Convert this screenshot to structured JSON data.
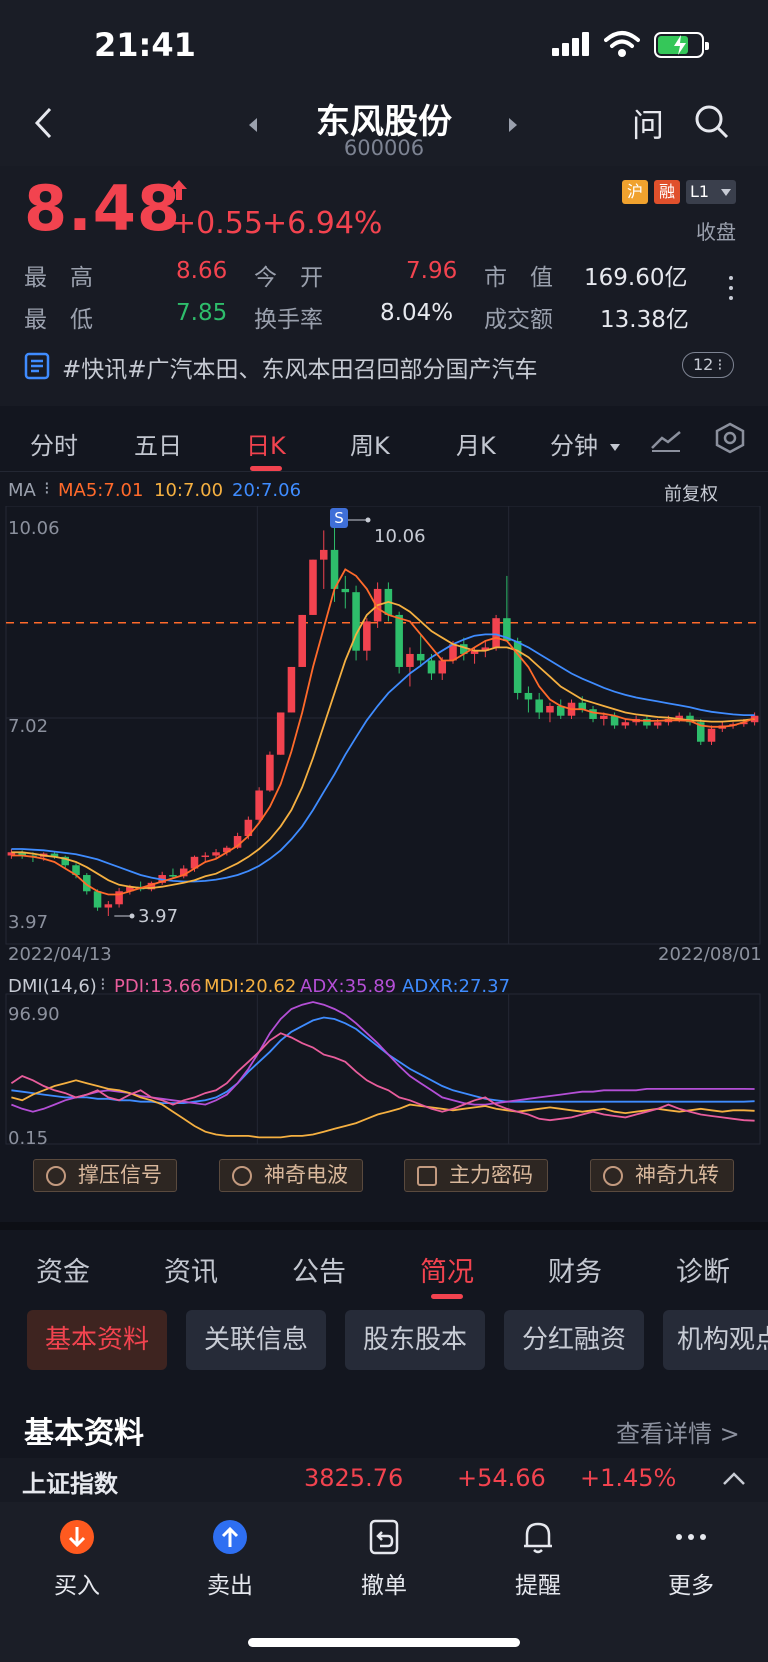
{
  "status": {
    "time": "21:41"
  },
  "nav": {
    "title": "东风股份",
    "code": "600006",
    "ask": "问"
  },
  "quote": {
    "price": "8.48",
    "change": "+0.55",
    "change_pct": "+6.94%",
    "tags": [
      "沪",
      "融",
      "L1"
    ],
    "market_state": "收盘",
    "high_label": "最　高",
    "high": "8.66",
    "open_label": "今　开",
    "open": "7.96",
    "mcap_label": "市　值",
    "mcap": "169.60亿",
    "low_label": "最　低",
    "low": "7.85",
    "turnover_label": "换手率",
    "turnover": "8.04%",
    "amount_label": "成交额",
    "amount": "13.38亿",
    "news": "#快讯#广汽本田、东风本田召回部分国产汽车",
    "news_count": "12"
  },
  "ktabs": [
    "分时",
    "五日",
    "日K",
    "周K",
    "月K",
    "分钟"
  ],
  "ktab_active": "日K",
  "ma_legend": {
    "label": "MA",
    "ma5": "MA5:7.01",
    "ma10": "10:7.00",
    "ma20": "20:7.06",
    "adjust": "前复权"
  },
  "price_axis": {
    "top": "10.06",
    "mid": "7.02",
    "bottom": "3.97"
  },
  "annotations": {
    "high": "10.06",
    "low": "3.97",
    "flag": "S"
  },
  "dates": {
    "start": "2022/04/13",
    "end": "2022/08/01"
  },
  "dmi": {
    "label": "DMI(14,6)",
    "pdi": "PDI:13.66",
    "mdi": "MDI:20.62",
    "adx": "ADX:35.89",
    "adxr": "ADXR:27.37",
    "top": "96.90",
    "bottom": "0.15"
  },
  "signals": [
    "撑压信号",
    "神奇电波",
    "主力密码",
    "神奇九转"
  ],
  "info_tabs": [
    "资金",
    "资讯",
    "公告",
    "简况",
    "财务",
    "诊断"
  ],
  "info_tab_active": "简况",
  "chips": [
    "基本资料",
    "关联信息",
    "股东股本",
    "分红融资",
    "机构观点"
  ],
  "section": {
    "title": "基本资料",
    "link": "查看详情 >"
  },
  "index_bar": {
    "name": "上证指数",
    "value": "3825.76",
    "change": "+54.66",
    "pct": "+1.45%"
  },
  "bottom_nav": [
    "买入",
    "卖出",
    "撤单",
    "提醒",
    "更多"
  ],
  "colors": {
    "up": "#f2434f",
    "down": "#2ebd6b",
    "ma5": "#ff6a2b",
    "ma10": "#f5b041",
    "ma20": "#3f8cff",
    "pdi": "#e85d9c",
    "mdi": "#f5b041",
    "adx": "#b44fd6",
    "adxr": "#3f8cff"
  },
  "chart_data": {
    "type": "candlestick",
    "title": "",
    "x_range": [
      "2022/04/13",
      "2022/08/01"
    ],
    "ylim": [
      3.97,
      10.06
    ],
    "reference_line": 8.48,
    "candles": [
      [
        4.9,
        5.0,
        4.85,
        4.95
      ],
      [
        4.95,
        4.98,
        4.85,
        4.9
      ],
      [
        4.9,
        4.95,
        4.8,
        4.88
      ],
      [
        4.88,
        4.95,
        4.82,
        4.93
      ],
      [
        4.93,
        4.96,
        4.85,
        4.88
      ],
      [
        4.88,
        4.9,
        4.7,
        4.75
      ],
      [
        4.75,
        4.78,
        4.55,
        4.6
      ],
      [
        4.6,
        4.63,
        4.3,
        4.35
      ],
      [
        4.35,
        4.38,
        4.05,
        4.1
      ],
      [
        4.1,
        4.2,
        3.97,
        4.15
      ],
      [
        4.15,
        4.4,
        4.1,
        4.35
      ],
      [
        4.35,
        4.45,
        4.3,
        4.42
      ],
      [
        4.42,
        4.5,
        4.35,
        4.38
      ],
      [
        4.38,
        4.5,
        4.35,
        4.48
      ],
      [
        4.48,
        4.65,
        4.45,
        4.6
      ],
      [
        4.6,
        4.7,
        4.55,
        4.58
      ],
      [
        4.58,
        4.75,
        4.55,
        4.7
      ],
      [
        4.7,
        4.9,
        4.65,
        4.88
      ],
      [
        4.88,
        4.95,
        4.8,
        4.9
      ],
      [
        4.9,
        5.0,
        4.85,
        4.95
      ],
      [
        4.95,
        5.05,
        4.9,
        5.02
      ],
      [
        5.02,
        5.25,
        5.0,
        5.2
      ],
      [
        5.2,
        5.5,
        5.15,
        5.45
      ],
      [
        5.45,
        5.95,
        5.4,
        5.9
      ],
      [
        5.9,
        6.5,
        5.88,
        6.45
      ],
      [
        6.45,
        7.1,
        6.45,
        7.1
      ],
      [
        7.1,
        7.8,
        7.1,
        7.8
      ],
      [
        7.8,
        8.6,
        7.8,
        8.6
      ],
      [
        8.6,
        9.45,
        8.6,
        9.45
      ],
      [
        9.45,
        9.9,
        9.0,
        9.6
      ],
      [
        9.6,
        10.06,
        8.8,
        9.0
      ],
      [
        9.0,
        9.2,
        8.7,
        8.95
      ],
      [
        8.95,
        9.05,
        7.9,
        8.05
      ],
      [
        8.05,
        8.55,
        7.9,
        8.5
      ],
      [
        8.5,
        9.1,
        8.4,
        9.0
      ],
      [
        9.0,
        9.1,
        8.5,
        8.6
      ],
      [
        8.6,
        8.65,
        7.7,
        7.8
      ],
      [
        7.8,
        8.1,
        7.5,
        8.0
      ],
      [
        8.0,
        8.3,
        7.8,
        7.9
      ],
      [
        7.9,
        8.0,
        7.6,
        7.7
      ],
      [
        7.7,
        7.95,
        7.6,
        7.9
      ],
      [
        7.9,
        8.2,
        7.85,
        8.15
      ],
      [
        8.15,
        8.25,
        7.9,
        8.0
      ],
      [
        8.0,
        8.1,
        7.85,
        8.05
      ],
      [
        8.05,
        8.2,
        7.95,
        8.1
      ],
      [
        8.1,
        8.6,
        8.05,
        8.55
      ],
      [
        8.55,
        9.2,
        8.2,
        8.2
      ],
      [
        8.2,
        8.25,
        7.3,
        7.4
      ],
      [
        7.4,
        7.5,
        7.1,
        7.3
      ],
      [
        7.3,
        7.4,
        7.0,
        7.1
      ],
      [
        7.1,
        7.25,
        6.95,
        7.2
      ],
      [
        7.2,
        7.3,
        7.0,
        7.05
      ],
      [
        7.05,
        7.3,
        7.0,
        7.25
      ],
      [
        7.25,
        7.35,
        7.1,
        7.15
      ],
      [
        7.15,
        7.2,
        6.95,
        7.0
      ],
      [
        7.0,
        7.1,
        6.9,
        7.05
      ],
      [
        7.05,
        7.1,
        6.85,
        6.9
      ],
      [
        6.9,
        7.0,
        6.85,
        6.95
      ],
      [
        6.95,
        7.05,
        6.9,
        7.0
      ],
      [
        7.0,
        7.05,
        6.85,
        6.9
      ],
      [
        6.9,
        7.0,
        6.85,
        6.95
      ],
      [
        6.95,
        7.05,
        6.9,
        7.0
      ],
      [
        7.0,
        7.1,
        6.95,
        7.05
      ],
      [
        7.05,
        7.1,
        6.9,
        6.95
      ],
      [
        6.95,
        7.0,
        6.6,
        6.65
      ],
      [
        6.65,
        6.9,
        6.6,
        6.85
      ],
      [
        6.85,
        6.95,
        6.8,
        6.9
      ],
      [
        6.9,
        6.95,
        6.85,
        6.92
      ],
      [
        6.92,
        7.0,
        6.88,
        6.95
      ],
      [
        6.95,
        7.1,
        6.9,
        7.05
      ]
    ],
    "ma5": [
      4.9,
      4.9,
      4.88,
      4.85,
      4.8,
      4.7,
      4.6,
      4.45,
      4.35,
      4.3,
      4.3,
      4.35,
      4.4,
      4.45,
      4.5,
      4.55,
      4.6,
      4.7,
      4.8,
      4.85,
      4.95,
      5.05,
      5.2,
      5.4,
      5.65,
      6.0,
      6.5,
      7.1,
      7.8,
      8.4,
      9.0,
      9.3,
      9.2,
      9.0,
      8.7,
      8.6,
      8.55,
      8.5,
      8.3,
      8.1,
      7.9,
      7.9,
      8.0,
      8.1,
      8.2,
      8.25,
      8.2,
      8.0,
      7.8,
      7.5,
      7.3,
      7.2,
      7.15,
      7.15,
      7.1,
      7.08,
      7.05,
      7.0,
      6.98,
      6.97,
      6.97,
      6.98,
      6.98,
      6.97,
      6.9,
      6.88,
      6.88,
      6.9,
      6.95,
      7.01
    ],
    "ma10": [
      4.95,
      4.95,
      4.93,
      4.9,
      4.88,
      4.85,
      4.8,
      4.72,
      4.62,
      4.52,
      4.45,
      4.42,
      4.4,
      4.4,
      4.42,
      4.45,
      4.48,
      4.52,
      4.58,
      4.62,
      4.7,
      4.78,
      4.88,
      5.0,
      5.15,
      5.35,
      5.6,
      5.95,
      6.4,
      6.9,
      7.4,
      7.9,
      8.3,
      8.6,
      8.75,
      8.8,
      8.75,
      8.65,
      8.5,
      8.35,
      8.25,
      8.15,
      8.1,
      8.05,
      8.05,
      8.1,
      8.1,
      8.05,
      7.95,
      7.8,
      7.65,
      7.5,
      7.4,
      7.3,
      7.25,
      7.2,
      7.15,
      7.1,
      7.07,
      7.05,
      7.03,
      7.02,
      7.0,
      6.98,
      6.97,
      6.96,
      6.96,
      6.97,
      6.98,
      7.0
    ],
    "ma20": [
      5.0,
      5.0,
      4.99,
      4.98,
      4.96,
      4.94,
      4.92,
      4.88,
      4.84,
      4.78,
      4.72,
      4.66,
      4.6,
      4.56,
      4.53,
      4.51,
      4.5,
      4.5,
      4.51,
      4.53,
      4.56,
      4.6,
      4.66,
      4.74,
      4.85,
      4.98,
      5.15,
      5.35,
      5.6,
      5.88,
      6.15,
      6.45,
      6.72,
      6.98,
      7.2,
      7.4,
      7.55,
      7.7,
      7.82,
      7.95,
      8.05,
      8.15,
      8.22,
      8.28,
      8.3,
      8.3,
      8.25,
      8.18,
      8.1,
      8.0,
      7.9,
      7.8,
      7.7,
      7.62,
      7.55,
      7.48,
      7.42,
      7.37,
      7.33,
      7.3,
      7.27,
      7.24,
      7.21,
      7.18,
      7.14,
      7.11,
      7.09,
      7.07,
      7.06,
      7.06
    ],
    "dmi": {
      "ylim": [
        0.15,
        96.9
      ],
      "pdi": [
        40,
        45,
        42,
        38,
        35,
        33,
        30,
        32,
        35,
        30,
        28,
        32,
        35,
        30,
        28,
        25,
        28,
        30,
        33,
        35,
        40,
        48,
        55,
        62,
        70,
        75,
        72,
        68,
        65,
        60,
        58,
        55,
        48,
        42,
        38,
        35,
        30,
        28,
        25,
        22,
        20,
        22,
        25,
        28,
        30,
        25,
        22,
        20,
        18,
        15,
        14,
        15,
        16,
        18,
        20,
        18,
        17,
        16,
        18,
        20,
        22,
        25,
        22,
        20,
        18,
        17,
        16,
        15,
        14,
        13.66
      ],
      "mdi": [
        30,
        28,
        32,
        35,
        38,
        40,
        42,
        40,
        38,
        36,
        35,
        33,
        30,
        28,
        25,
        20,
        15,
        10,
        6,
        4,
        3,
        3,
        3,
        2,
        2,
        2,
        3,
        3,
        4,
        6,
        8,
        10,
        12,
        15,
        18,
        20,
        22,
        25,
        24,
        23,
        22,
        21,
        22,
        23,
        24,
        22,
        21,
        20,
        21,
        22,
        23,
        22,
        21,
        20,
        21,
        22,
        20,
        19,
        20,
        21,
        22,
        21,
        20,
        21,
        22,
        21,
        20,
        21,
        21,
        20.62
      ],
      "adx": [
        25,
        22,
        20,
        22,
        25,
        28,
        30,
        32,
        34,
        35,
        34,
        33,
        31,
        30,
        29,
        28,
        27,
        26,
        25,
        28,
        32,
        40,
        50,
        62,
        75,
        85,
        92,
        95,
        96.9,
        95,
        92,
        88,
        82,
        75,
        68,
        60,
        52,
        45,
        40,
        35,
        30,
        28,
        26,
        25,
        25,
        26,
        27,
        28,
        29,
        30,
        31,
        32,
        33,
        34,
        34,
        35,
        35,
        35,
        35,
        36,
        36,
        36,
        36,
        36,
        36,
        36,
        36,
        36,
        36,
        35.89
      ],
      "adxr": [
        35,
        34,
        33,
        32,
        31,
        30,
        30,
        30,
        29,
        29,
        28,
        28,
        27,
        27,
        26,
        26,
        26,
        27,
        28,
        30,
        34,
        40,
        48,
        55,
        62,
        70,
        76,
        80,
        84,
        86,
        85,
        82,
        78,
        72,
        66,
        60,
        55,
        50,
        46,
        42,
        38,
        35,
        33,
        31,
        29,
        28,
        27,
        27,
        27,
        27,
        27,
        27,
        27,
        27,
        27,
        27,
        27,
        27,
        27,
        27,
        27,
        27,
        27,
        27,
        27,
        27,
        27,
        27,
        27,
        27.37
      ]
    }
  }
}
